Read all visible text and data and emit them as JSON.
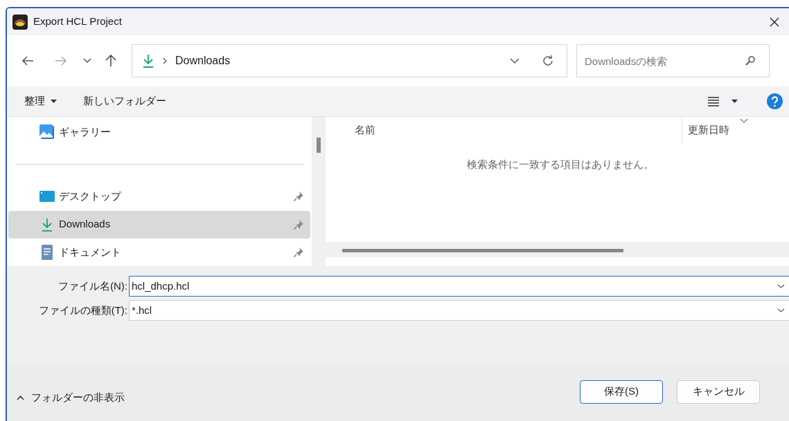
{
  "window": {
    "title": "Export HCL Project"
  },
  "navigation": {
    "path": "Downloads",
    "search_placeholder": "Downloadsの検索"
  },
  "toolbar": {
    "organize": "整理",
    "new_folder": "新しいフォルダー"
  },
  "sidebar": {
    "items": [
      {
        "kind": "gallery",
        "label": "ギャラリー",
        "pinned": false,
        "selected": false
      },
      {
        "kind": "divider"
      },
      {
        "kind": "desktop",
        "label": "デスクトップ",
        "pinned": true,
        "selected": false
      },
      {
        "kind": "downloads",
        "label": "Downloads",
        "pinned": true,
        "selected": true
      },
      {
        "kind": "documents",
        "label": "ドキュメント",
        "pinned": true,
        "selected": false
      }
    ]
  },
  "file_list": {
    "columns": [
      "名前",
      "更新日時"
    ],
    "empty_message": "検索条件に一致する項目はありません。"
  },
  "fields": [
    {
      "label": "ファイル名(N):",
      "value": "hcl_dhcp.hcl",
      "focused": true
    },
    {
      "label": "ファイルの種類(T):",
      "value": "*.hcl",
      "focused": false
    }
  ],
  "footer": {
    "hide_folders": "フォルダーの非表示",
    "buttons": [
      {
        "label": "保存(S)",
        "default": true
      },
      {
        "label": "キャンセル",
        "default": false
      }
    ]
  }
}
